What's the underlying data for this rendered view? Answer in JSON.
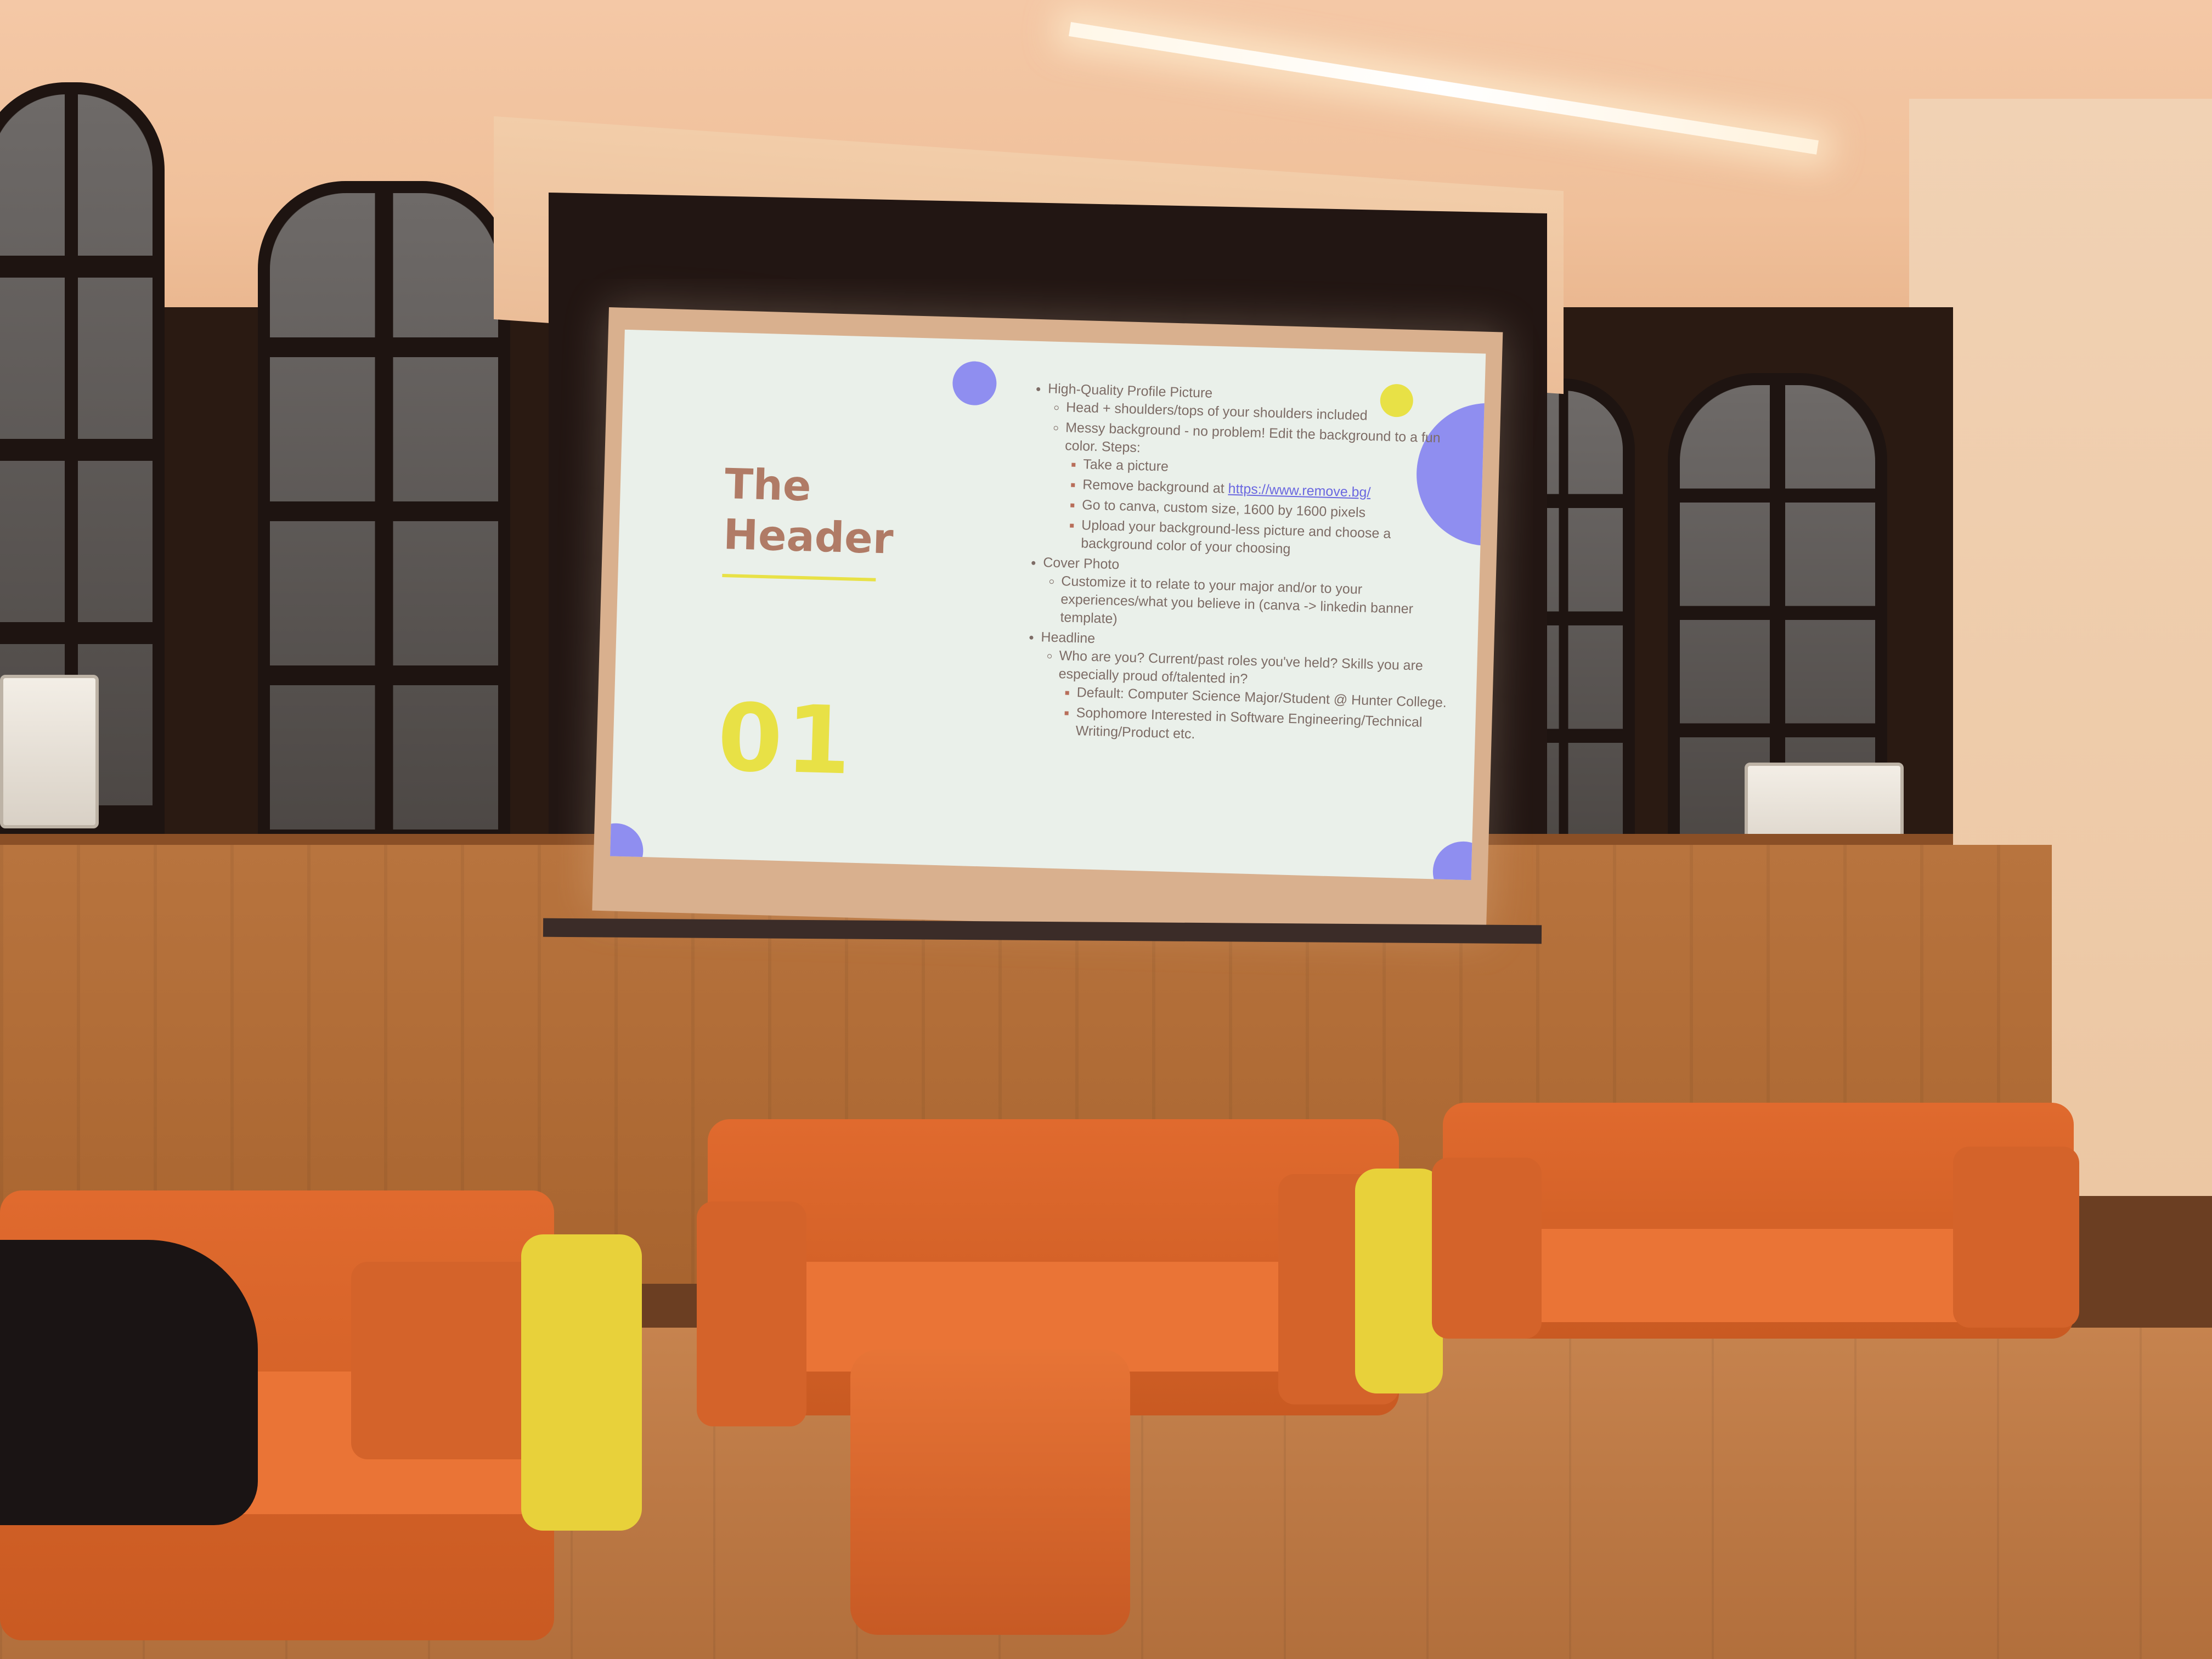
{
  "slide": {
    "title_line1": "The",
    "title_line2": "Header",
    "number": "01",
    "bullets": {
      "profile_picture": "High-Quality Profile Picture",
      "head_shoulders": "Head + shoulders/tops of your shoulders included",
      "messy_background": "Messy background - no problem! Edit the background to a fun color. Steps:",
      "step_take_picture": "Take a picture",
      "step_remove_bg_prefix": "Remove background at ",
      "step_remove_bg_link": "https://www.remove.bg/",
      "step_canva": "Go to canva, custom size, 1600 by 1600 pixels",
      "step_upload": "Upload your background-less picture and choose a background color of your choosing",
      "cover_photo": "Cover Photo",
      "cover_photo_detail": "Customize it to relate to your major and/or to your experiences/what you believe in (canva -> linkedin banner template)",
      "headline": "Headline",
      "headline_detail": "Who are you? Current/past roles you've held? Skills you are especially proud of/talented in?",
      "headline_default": "Default: Computer Science Major/Student @ Hunter College.",
      "headline_example": "Sophomore Interested in Software Engineering/Technical Writing/Product etc."
    }
  },
  "colors": {
    "slide_bg": "#eaf0ea",
    "accent_purple": "#8f8ef0",
    "accent_yellow": "#e8e146",
    "title_color": "#b07b66",
    "couch_orange": "#e06a2e"
  }
}
